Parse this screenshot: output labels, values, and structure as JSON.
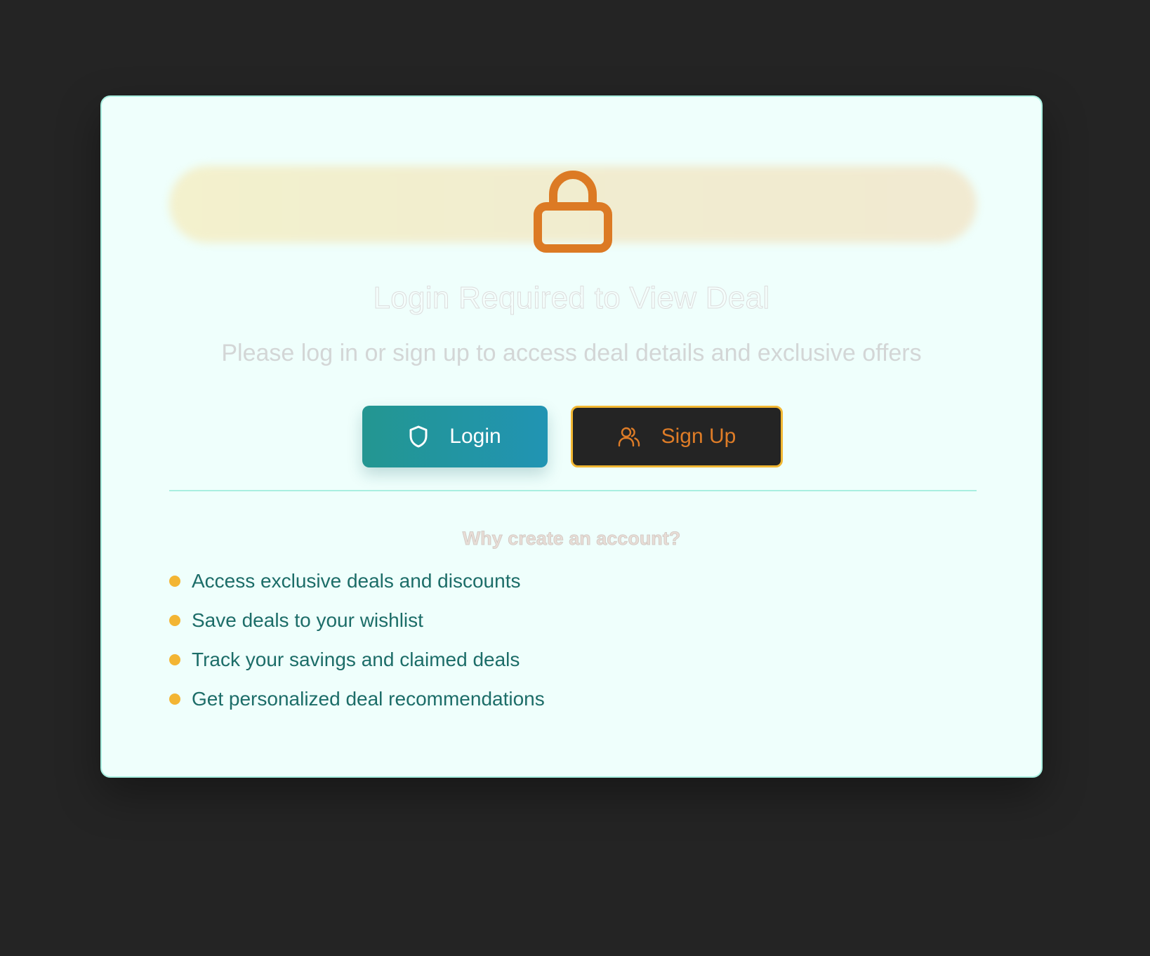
{
  "modal": {
    "title": "Login Required to View Deal",
    "subtitle": "Please log in or sign up to access deal details and exclusive offers",
    "icon": "lock-icon"
  },
  "actions": {
    "login_label": "Login",
    "login_icon": "shield-icon",
    "signup_label": "Sign Up",
    "signup_icon": "users-icon"
  },
  "benefits": {
    "heading": "Why create an account?",
    "items": [
      "Access exclusive deals and discounts",
      "Save deals to your wishlist",
      "Track your savings and claimed deals",
      "Get personalized deal recommendations"
    ]
  },
  "colors": {
    "background": "#242424",
    "card": "#effffc",
    "accent_teal": "#239691",
    "accent_orange": "#de7c27",
    "accent_yellow": "#f3b533"
  }
}
